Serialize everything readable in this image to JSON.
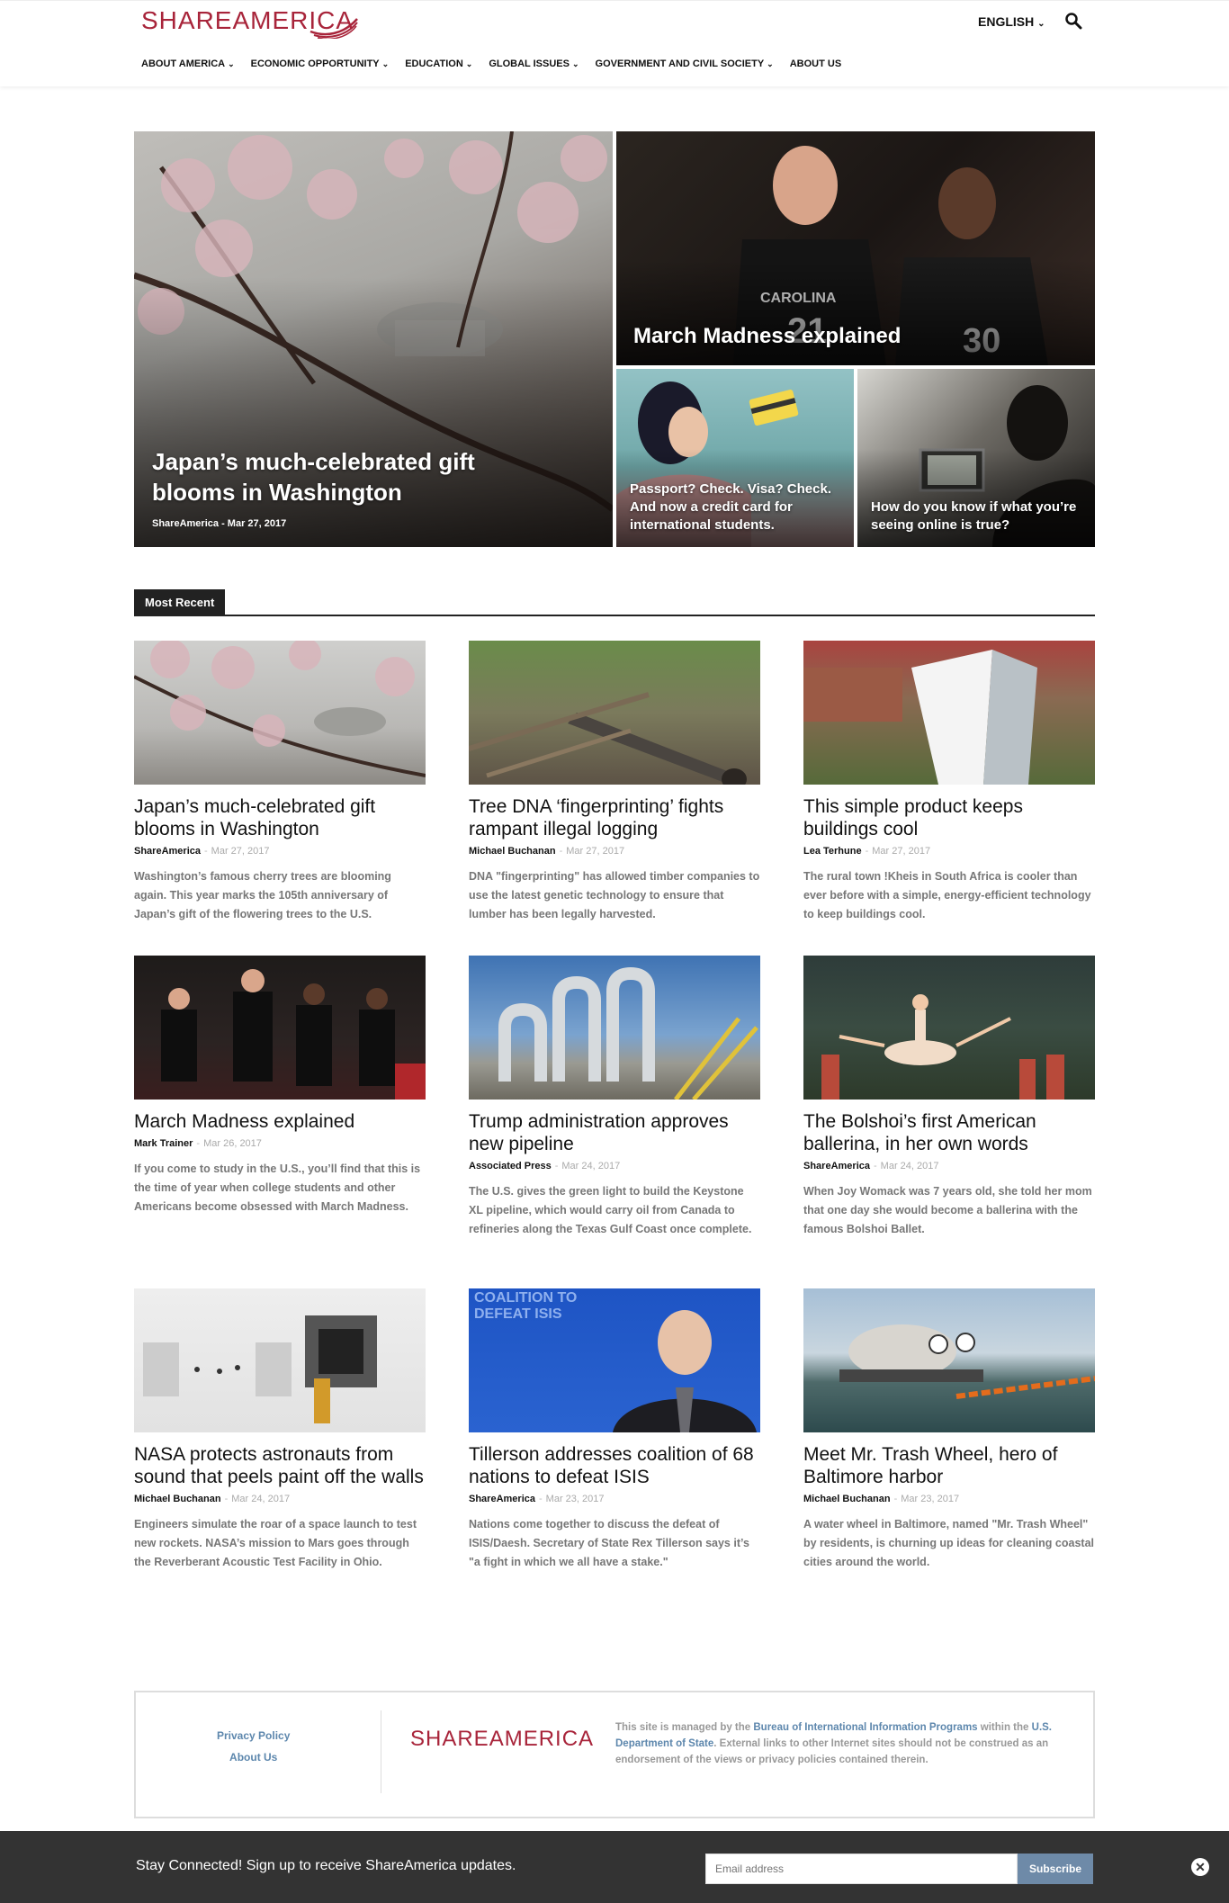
{
  "brand": {
    "name": "SHAREAMERICA",
    "color": "#a8243a"
  },
  "header": {
    "language": "ENGLISH",
    "search_icon": "search-icon",
    "nav": [
      {
        "label": "ABOUT AMERICA"
      },
      {
        "label": "ECONOMIC OPPORTUNITY"
      },
      {
        "label": "EDUCATION"
      },
      {
        "label": "GLOBAL ISSUES"
      },
      {
        "label": "GOVERNMENT AND CIVIL SOCIETY"
      },
      {
        "label": "ABOUT US"
      }
    ]
  },
  "hero": {
    "main": {
      "title": "Japan’s much-celebrated gift blooms in Washington",
      "author": "ShareAmerica",
      "date": "Mar 27, 2017"
    },
    "top_right": {
      "title": "March Madness explained"
    },
    "bottom_left": {
      "title": "Passport? Check. Visa? Check. And now a credit card for international students."
    },
    "bottom_right": {
      "title": "How do you know if what you’re seeing online is true?"
    }
  },
  "section": {
    "heading": "Most Recent"
  },
  "articles": [
    {
      "title": "Japan’s much-celebrated gift blooms in Washington",
      "author": "ShareAmerica",
      "date": "Mar 27, 2017",
      "excerpt": "Washington’s famous cherry trees are blooming again. This year marks the 105th anniversary of Japan’s gift of the flowering trees to the U.S."
    },
    {
      "title": "Tree DNA ‘fingerprinting’ fights rampant illegal logging",
      "author": "Michael Buchanan",
      "date": "Mar 27, 2017",
      "excerpt": "DNA \"fingerprinting\" has allowed timber companies to use the latest genetic technology to ensure that lumber has been legally harvested."
    },
    {
      "title": "This simple product keeps buildings cool",
      "author": "Lea Terhune",
      "date": "Mar 27, 2017",
      "excerpt": "The rural town !Kheis in South Africa is cooler than ever before with a simple, energy-efficient technology to keep buildings cool."
    },
    {
      "title": "March Madness explained",
      "author": "Mark Trainer",
      "date": "Mar 26, 2017",
      "excerpt": "If you come to study in the U.S., you’ll find that this is the time of year when college students and other Americans become obsessed with March Madness."
    },
    {
      "title": "Trump administration approves new pipeline",
      "author": "Associated Press",
      "date": "Mar 24, 2017",
      "excerpt": "The U.S. gives the green light to build the Keystone XL pipeline, which would carry oil from Canada to refineries along the Texas Gulf Coast once complete."
    },
    {
      "title": "The Bolshoi’s first American ballerina, in her own words",
      "author": "ShareAmerica",
      "date": "Mar 24, 2017",
      "excerpt": "When Joy Womack was 7 years old, she told her mom that one day she would become a ballerina with the famous Bolshoi Ballet."
    },
    {
      "title": "NASA protects astronauts from sound that peels paint off the walls",
      "author": "Michael Buchanan",
      "date": "Mar 24, 2017",
      "excerpt": "Engineers simulate the roar of a space launch to test new rockets. NASA’s mission to Mars goes through the Reverberant Acoustic Test Facility in Ohio."
    },
    {
      "title": "Tillerson addresses coalition of 68 nations to defeat ISIS",
      "author": "ShareAmerica",
      "date": "Mar 23, 2017",
      "excerpt": "Nations come together to discuss the defeat of ISIS/Daesh. Secretary of State Rex Tillerson says it’s \"a fight in which we all have a stake.\"",
      "image_text": "COALITION TO DEFEAT ISIS"
    },
    {
      "title": "Meet Mr. Trash Wheel, hero of Baltimore harbor",
      "author": "Michael Buchanan",
      "date": "Mar 23, 2017",
      "excerpt": "A water wheel in Baltimore, named \"Mr. Trash Wheel\" by residents, is churning up ideas for cleaning coastal cities around the world."
    }
  ],
  "footer": {
    "links": [
      "Privacy Policy",
      "About Us"
    ],
    "text_1": "This site is managed by the ",
    "link_1": "Bureau of International Information Programs",
    "text_2": " within the ",
    "link_2": "U.S. Department of State",
    "text_3": ". External links to other Internet sites should not be construed as an endorsement of the views or privacy policies contained therein."
  },
  "subscribe_bar": {
    "text": "Stay Connected! Sign up to receive ShareAmerica updates.",
    "placeholder": "Email address",
    "button": "Subscribe",
    "close_icon": "close-icon"
  }
}
